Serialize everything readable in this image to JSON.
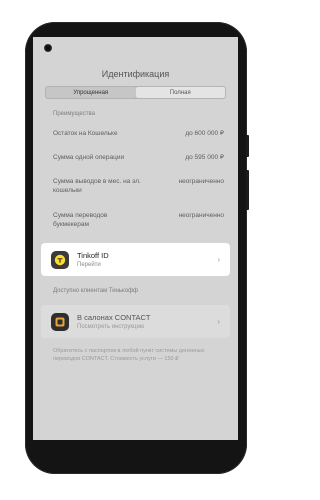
{
  "screen": {
    "title": "Идентификация",
    "tabs": [
      {
        "label": "Упрощенная",
        "active": true
      },
      {
        "label": "Полная",
        "active": false
      }
    ],
    "advantages_label": "Преимущества",
    "rows": [
      {
        "label": "Остаток на Кошельке",
        "value": "до 600 000 ₽"
      },
      {
        "label": "Сумма одной операции",
        "value": "до 595 000 ₽"
      },
      {
        "label": "Сумма выводов в мес. на эл. кошельки",
        "value": "неограниченно"
      },
      {
        "label": "Сумма переводов букмекерам",
        "value": "неограниченно"
      }
    ],
    "tinkoff_card": {
      "title": "Tinkoff ID",
      "subtitle": "Перейти",
      "icon": "tinkoff-logo-icon"
    },
    "available_label": "Доступно клиентам Тинькофф",
    "contact_card": {
      "title": "В салонах CONTACT",
      "subtitle": "Посмотреть инструкцию",
      "icon": "contact-logo-icon"
    },
    "note": "Обратитесь с паспортом в любой пункт системы денежных переводов CONTACT. Стоимость услуги — 150 ₽"
  },
  "colors": {
    "phone_body": "#141414",
    "screen_overlay": "#d4d4d4",
    "card_highlight": "#ffffff",
    "tinkoff_yellow": "#ffdd2d"
  }
}
